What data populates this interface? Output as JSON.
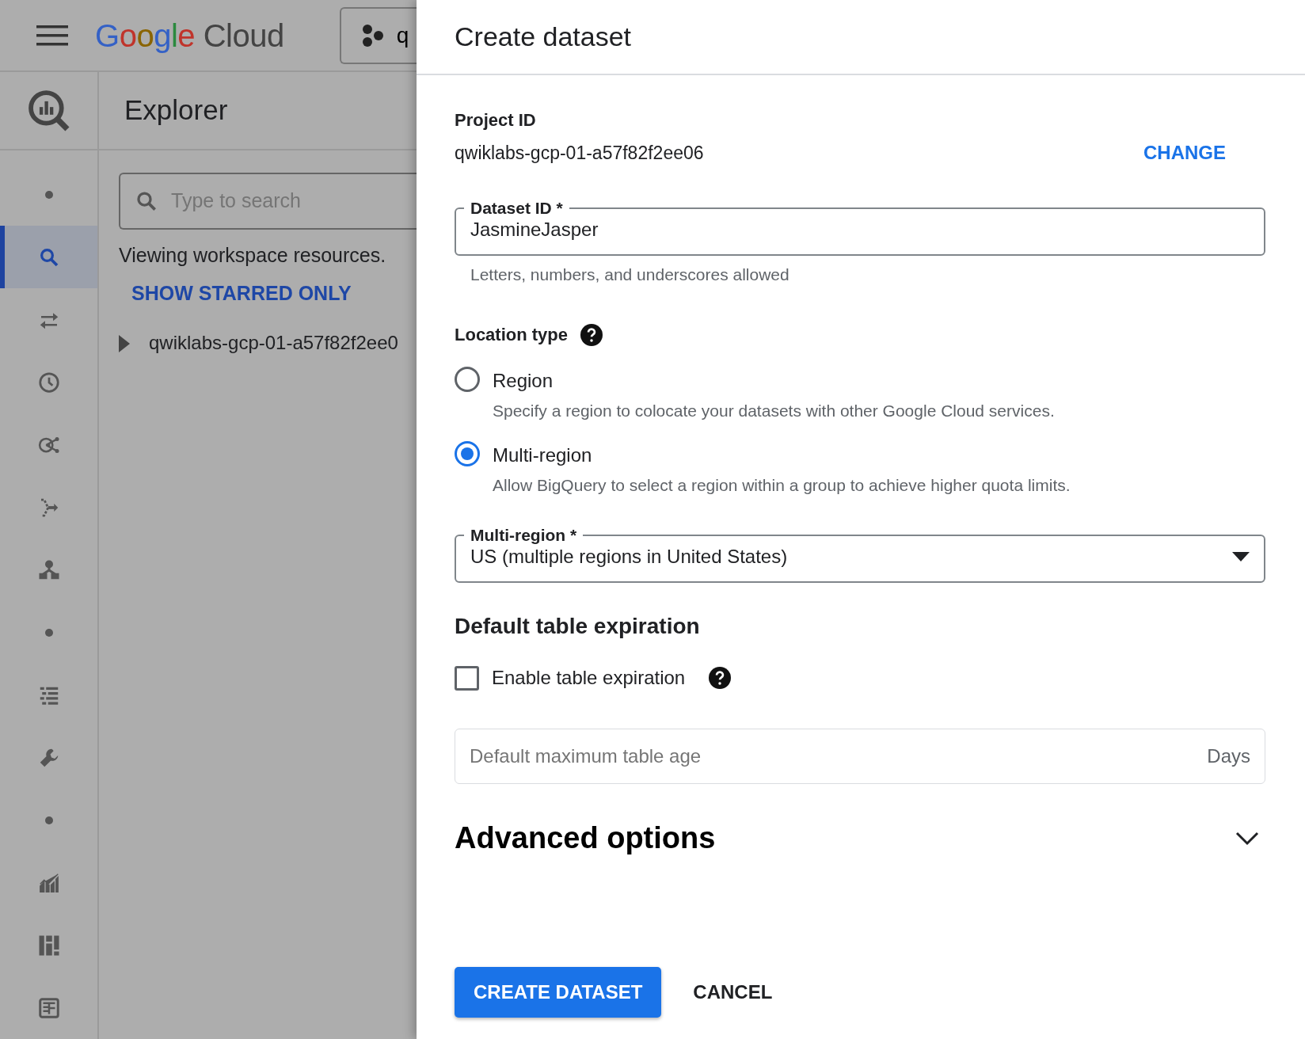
{
  "header": {
    "logo": "Google Cloud",
    "project_picker": "q"
  },
  "sidebar": {
    "items": [
      {
        "kind": "dot",
        "selected": false
      },
      {
        "kind": "icon",
        "selected": true
      },
      {
        "kind": "icon",
        "selected": false
      },
      {
        "kind": "icon",
        "selected": false
      },
      {
        "kind": "icon",
        "selected": false
      },
      {
        "kind": "icon",
        "selected": false
      },
      {
        "kind": "icon",
        "selected": false
      },
      {
        "kind": "dot",
        "selected": false
      },
      {
        "kind": "icon",
        "selected": false
      },
      {
        "kind": "icon",
        "selected": false
      },
      {
        "kind": "dot",
        "selected": false
      },
      {
        "kind": "icon",
        "selected": false
      },
      {
        "kind": "icon",
        "selected": false
      },
      {
        "kind": "icon",
        "selected": false
      }
    ]
  },
  "explorer": {
    "title": "Explorer",
    "search": {
      "placeholder": "Type to search"
    },
    "info": "Viewing workspace resources.",
    "starred_link": "SHOW STARRED ONLY",
    "tree": [
      {
        "label": "qwiklabs-gcp-01-a57f82f2ee0",
        "expanded": false
      }
    ]
  },
  "panel": {
    "title": "Create dataset",
    "project": {
      "label": "Project ID",
      "value": "qwiklabs-gcp-01-a57f82f2ee06",
      "change": "CHANGE"
    },
    "dataset_id": {
      "label": "Dataset ID *",
      "value": "JasmineJasper",
      "helper": "Letters, numbers, and underscores allowed"
    },
    "location_type": {
      "label": "Location type",
      "options": [
        {
          "label": "Region",
          "description": "Specify a region to colocate your datasets with other Google Cloud services.",
          "selected": false
        },
        {
          "label": "Multi-region",
          "description": "Allow BigQuery to select a region within a group to achieve higher quota limits.",
          "selected": true
        }
      ]
    },
    "multi_region": {
      "label": "Multi-region *",
      "value": "US (multiple regions in United States)"
    },
    "expiration": {
      "title": "Default table expiration",
      "checkbox": {
        "label": "Enable table expiration",
        "checked": false
      },
      "field": {
        "placeholder": "Default maximum table age",
        "suffix": "Days"
      }
    },
    "advanced": {
      "title": "Advanced options",
      "expanded": false
    },
    "buttons": [
      {
        "label": "CREATE DATASET",
        "kind": "primary"
      },
      {
        "label": "CANCEL",
        "kind": "text"
      }
    ]
  }
}
